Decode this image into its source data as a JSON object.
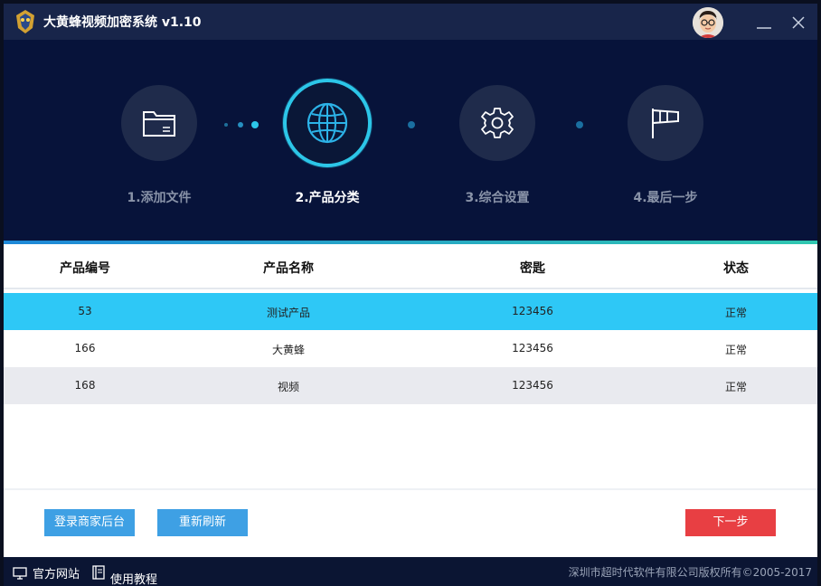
{
  "app": {
    "title": "大黄蜂视频加密系统 v1.10",
    "minimize_icon": "minimize-icon",
    "close_icon": "close-icon"
  },
  "steps": [
    {
      "label": "1.添加文件",
      "icon": "folder-icon",
      "active": false
    },
    {
      "label": "2.产品分类",
      "icon": "globe-icon",
      "active": true
    },
    {
      "label": "3.综合设置",
      "icon": "gear-icon",
      "active": false
    },
    {
      "label": "4.最后一步",
      "icon": "flag-icon",
      "active": false
    }
  ],
  "table": {
    "headers": [
      "产品编号",
      "产品名称",
      "密匙",
      "状态"
    ],
    "rows": [
      {
        "id": "53",
        "name": "测试产品",
        "key": "123456",
        "status": "正常",
        "selected": true
      },
      {
        "id": "166",
        "name": "大黄蜂",
        "key": "123456",
        "status": "正常",
        "selected": false
      },
      {
        "id": "168",
        "name": "视频",
        "key": "123456",
        "status": "正常",
        "selected": false
      }
    ]
  },
  "buttons": {
    "merchant_login": "登录商家后台",
    "refresh": "重新刷新",
    "next": "下一步"
  },
  "statusbar": {
    "website": "官方网站",
    "tutorial": "使用教程",
    "copyright": "深圳市超时代软件有限公司版权所有©2005-2017"
  },
  "colors": {
    "accent": "#2cc6e8",
    "selected_row": "#2ec8f6",
    "alt_row": "#e9eaef",
    "button_blue": "#3ea0e4",
    "button_red": "#e83f43",
    "header_bg": "#07133a"
  }
}
